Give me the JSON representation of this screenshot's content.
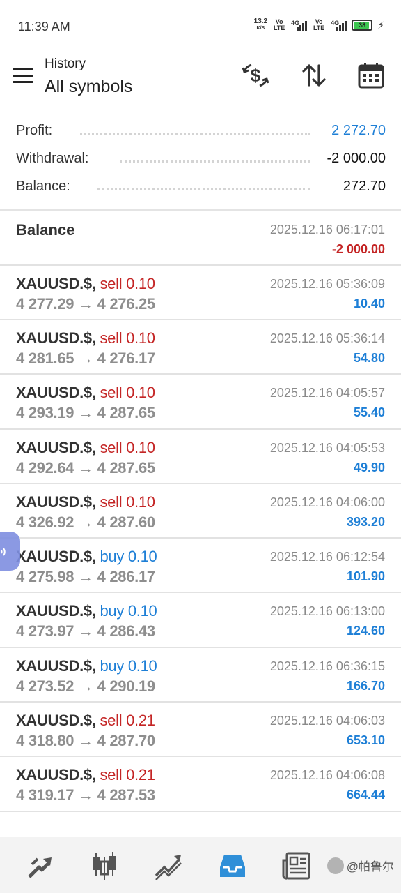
{
  "status_bar": {
    "time": "11:39 AM",
    "net_speed": "13.2",
    "net_speed_unit": "K/S",
    "volte1": "Vo LTE",
    "net1": "4G",
    "volte2": "Vo LTE",
    "net2": "4G",
    "battery": "38"
  },
  "app_bar": {
    "subtitle": "History",
    "title": "All symbols",
    "icons": [
      "currency-exchange-icon",
      "sort-icon",
      "calendar-icon"
    ]
  },
  "summary": {
    "profit_label": "Profit:",
    "profit_value": "2 272.70",
    "withdrawal_label": "Withdrawal:",
    "withdrawal_value": "-2 000.00",
    "balance_label": "Balance:",
    "balance_value": "272.70"
  },
  "balance_entry": {
    "title": "Balance",
    "time": "2025.12.16 06:17:01",
    "amount": "-2 000.00"
  },
  "deals": [
    {
      "symbol": "XAUUSD.$,",
      "side": "sell",
      "volume": "0.10",
      "open": "4 277.29",
      "close": "4 276.25",
      "time": "2025.12.16 05:36:09",
      "profit": "10.40"
    },
    {
      "symbol": "XAUUSD.$,",
      "side": "sell",
      "volume": "0.10",
      "open": "4 281.65",
      "close": "4 276.17",
      "time": "2025.12.16 05:36:14",
      "profit": "54.80"
    },
    {
      "symbol": "XAUUSD.$,",
      "side": "sell",
      "volume": "0.10",
      "open": "4 293.19",
      "close": "4 287.65",
      "time": "2025.12.16 04:05:57",
      "profit": "55.40"
    },
    {
      "symbol": "XAUUSD.$,",
      "side": "sell",
      "volume": "0.10",
      "open": "4 292.64",
      "close": "4 287.65",
      "time": "2025.12.16 04:05:53",
      "profit": "49.90"
    },
    {
      "symbol": "XAUUSD.$,",
      "side": "sell",
      "volume": "0.10",
      "open": "4 326.92",
      "close": "4 287.60",
      "time": "2025.12.16 04:06:00",
      "profit": "393.20"
    },
    {
      "symbol": "XAUUSD.$,",
      "side": "buy",
      "volume": "0.10",
      "open": "4 275.98",
      "close": "4 286.17",
      "time": "2025.12.16 06:12:54",
      "profit": "101.90"
    },
    {
      "symbol": "XAUUSD.$,",
      "side": "buy",
      "volume": "0.10",
      "open": "4 273.97",
      "close": "4 286.43",
      "time": "2025.12.16 06:13:00",
      "profit": "124.60"
    },
    {
      "symbol": "XAUUSD.$,",
      "side": "buy",
      "volume": "0.10",
      "open": "4 273.52",
      "close": "4 290.19",
      "time": "2025.12.16 06:36:15",
      "profit": "166.70"
    },
    {
      "symbol": "XAUUSD.$,",
      "side": "sell",
      "volume": "0.21",
      "open": "4 318.80",
      "close": "4 287.70",
      "time": "2025.12.16 04:06:03",
      "profit": "653.10"
    },
    {
      "symbol": "XAUUSD.$,",
      "side": "sell",
      "volume": "0.21",
      "open": "4 319.17",
      "close": "4 287.53",
      "time": "2025.12.16 04:06:08",
      "profit": "664.44"
    }
  ],
  "arrow": "→",
  "bottom_nav": {
    "items": [
      "trade-arrows-icon",
      "candlestick-chart-icon",
      "line-chart-icon",
      "history-inbox-icon",
      "news-icon"
    ],
    "active": "history-inbox-icon",
    "watermark": "@帕鲁尔"
  },
  "colors": {
    "sell": "#c42525",
    "buy": "#1e7fd6",
    "profit_positive": "#1e7fd6",
    "profit_negative": "#c42525",
    "nav_active": "#2f8fd8"
  }
}
